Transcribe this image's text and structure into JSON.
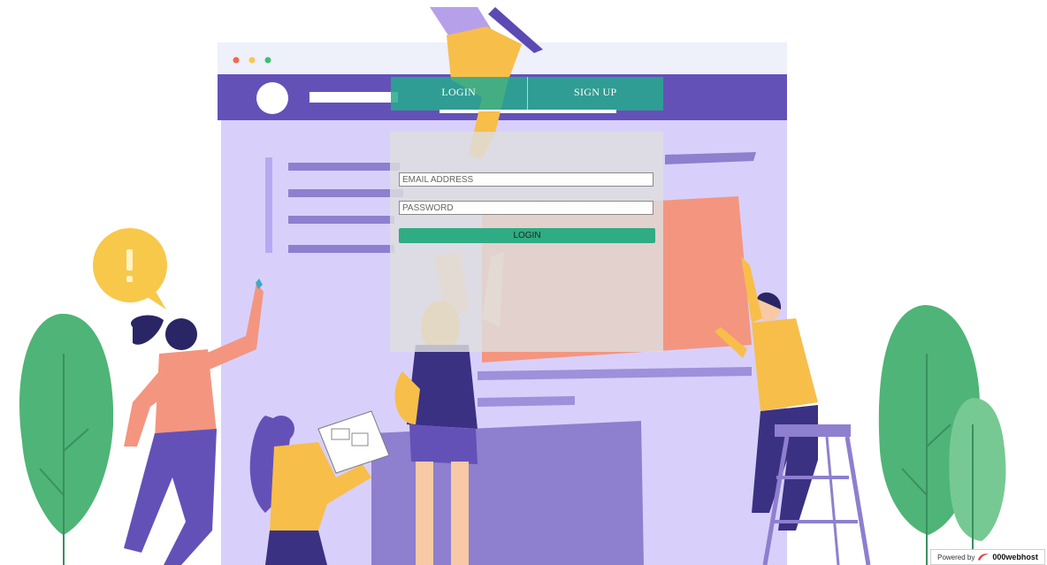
{
  "tabs": {
    "login_label": "LOGIN",
    "signup_label": "SIGN UP"
  },
  "form": {
    "email_placeholder": "EMAIL ADDRESS",
    "password_placeholder": "PASSWORD",
    "submit_label": "LOGIN"
  },
  "footer": {
    "powered_by": "Powered by",
    "brand": "000webhost"
  },
  "colors": {
    "accent": "#2fac83",
    "browser_purple": "#6451b8",
    "page_lavender": "#d8d0fb",
    "coral": "#f4957f",
    "mustard": "#f8be4a",
    "leaf_green": "#4fb477"
  },
  "icons": {
    "badge_logo": "000webhost-swoosh-icon",
    "alert": "exclamation-bubble-icon"
  }
}
